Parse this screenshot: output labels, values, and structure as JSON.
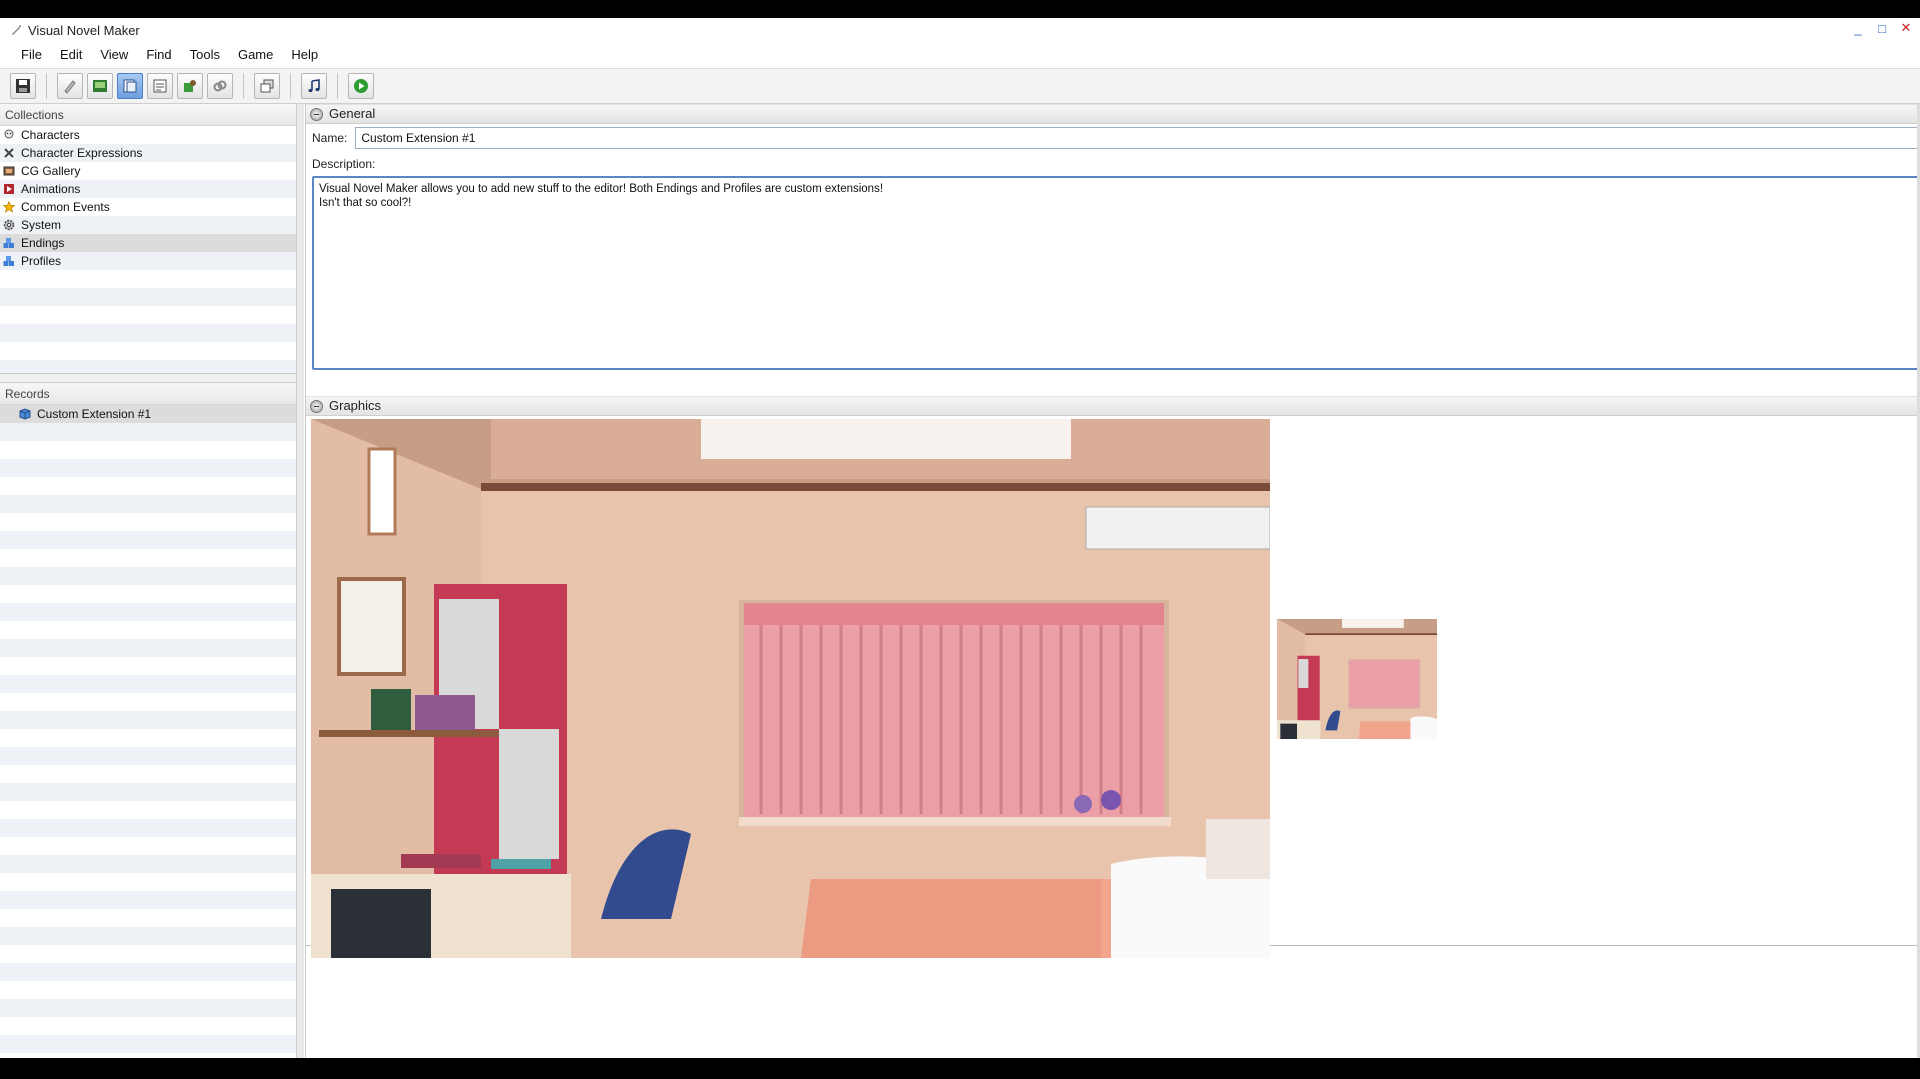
{
  "window": {
    "title": "Visual Novel Maker"
  },
  "menu": [
    "File",
    "Edit",
    "View",
    "Find",
    "Tools",
    "Game",
    "Help"
  ],
  "toolbar": {
    "buttons": [
      "save-icon",
      "pen-icon",
      "image-icon",
      "database-icon",
      "script-icon",
      "puzzle-icon",
      "link-icon",
      "layers-icon",
      "music-icon",
      "play-icon"
    ],
    "active": "database-icon"
  },
  "collections": {
    "header": "Collections",
    "items": [
      {
        "label": "Characters",
        "icon": "character-icon"
      },
      {
        "label": "Character Expressions",
        "icon": "expression-icon"
      },
      {
        "label": "CG Gallery",
        "icon": "gallery-icon"
      },
      {
        "label": "Animations",
        "icon": "animation-icon"
      },
      {
        "label": "Common Events",
        "icon": "star-icon"
      },
      {
        "label": "System",
        "icon": "gear-icon"
      },
      {
        "label": "Endings",
        "icon": "extension-icon"
      },
      {
        "label": "Profiles",
        "icon": "extension-icon"
      }
    ],
    "selected": "Endings"
  },
  "records": {
    "header": "Records",
    "items": [
      {
        "label": "Custom Extension #1",
        "icon": "cube-icon"
      }
    ]
  },
  "general": {
    "header": "General",
    "name_label": "Name:",
    "name_value": "Custom Extension #1",
    "description_label": "Description:",
    "description_value": "Visual Novel Maker allows you to add new stuff to the editor! Both Endings and Profiles are custom extensions!\nIsn't that so cool?!"
  },
  "graphics": {
    "header": "Graphics"
  },
  "colors": {
    "accent": "#5b86c5",
    "selection": "#dcdcdc"
  }
}
